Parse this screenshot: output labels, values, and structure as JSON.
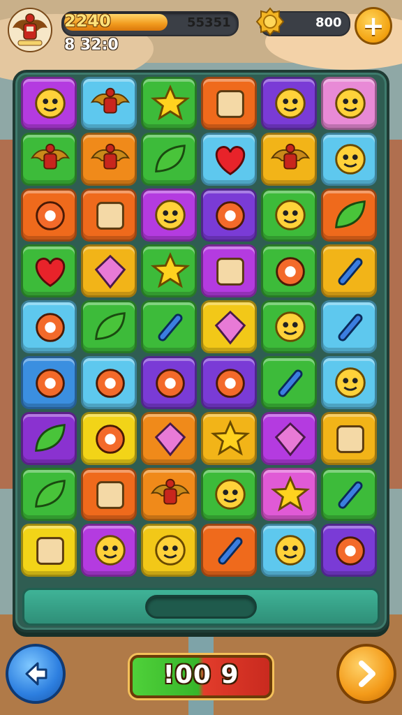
{
  "hud": {
    "level": "2240",
    "score": "55351",
    "sub_stat": "8 32:0",
    "xp_progress": 0.6,
    "coins": "800",
    "plus_label": "+"
  },
  "board": {
    "rows": 9,
    "cols": 6,
    "tiles": [
      [
        "#b43be0",
        "#5ec8ee",
        "#3dbb3a",
        "#ef6a1c",
        "#7a3bd6",
        "#e88ad6"
      ],
      [
        "#3dbb3a",
        "#f08a1a",
        "#3dbb3a",
        "#5ec8ee",
        "#f2b418",
        "#5ec8ee"
      ],
      [
        "#ef6a1c",
        "#ef6a1c",
        "#b43be0",
        "#7a3bd6",
        "#3dbb3a",
        "#ef6a1c"
      ],
      [
        "#3dbb3a",
        "#f2b418",
        "#3dbb3a",
        "#b43be0",
        "#3dbb3a",
        "#f2b418"
      ],
      [
        "#5ec8ee",
        "#3dbb3a",
        "#3dbb3a",
        "#f2c818",
        "#3dbb3a",
        "#5ec8ee"
      ],
      [
        "#3b8fe0",
        "#5ec8ee",
        "#7a3bd6",
        "#7a3bd6",
        "#3dbb3a",
        "#5ec8ee"
      ],
      [
        "#8a32d0",
        "#f2d418",
        "#f08a1a",
        "#f2b418",
        "#b43be0",
        "#f2b418"
      ],
      [
        "#3dbb3a",
        "#ef6a1c",
        "#f08a1a",
        "#3dbb3a",
        "#e05ad6",
        "#3dbb3a"
      ],
      [
        "#f2d418",
        "#b43be0",
        "#f2c818",
        "#ef6a1c",
        "#5ec8ee",
        "#7a3bd6"
      ]
    ],
    "icons": [
      [
        "winged-skull-icon",
        "garuda-crest-icon",
        "star-icon",
        "bread-icon",
        "fire-cat-icon",
        "yellow-face-icon"
      ],
      [
        "garuda-crest-icon",
        "garuda-crest-icon",
        "swirl-icon",
        "heart-icon",
        "garuda-crest-icon",
        "fox-face-icon"
      ],
      [
        "donut-icon",
        "teapot-icon",
        "monster-icon",
        "apple-icon",
        "mouse-icon",
        "leaf-icon"
      ],
      [
        "heart-icon",
        "crystal-icon",
        "cookie-star-icon",
        "book-icon",
        "egg-icon",
        "pencil-icon"
      ],
      [
        "peach-icon",
        "banana-icon",
        "brush-icon",
        "gem-icon",
        "blob-face-icon",
        "arrow-icon"
      ],
      [
        "ring-icon",
        "orange-icon",
        "ice-cream-icon",
        "berry-icon",
        "pepper-icon",
        "bear-face-icon"
      ],
      [
        "snake-icon",
        "mushroom-icon",
        "envelope-icon",
        "star-wand-icon",
        "diamond-icon",
        "camera-icon"
      ],
      [
        "leaf-knife-icon",
        "teapot-icon",
        "garuda-crest-icon",
        "smile-face-icon",
        "pink-star-icon",
        "crayon-icon"
      ],
      [
        "picture-frame-icon",
        "cow-face-icon",
        "cookie-face-icon",
        "microphone-icon",
        "sun-face-icon",
        "globe-icon"
      ]
    ]
  },
  "moves": "!00 9"
}
